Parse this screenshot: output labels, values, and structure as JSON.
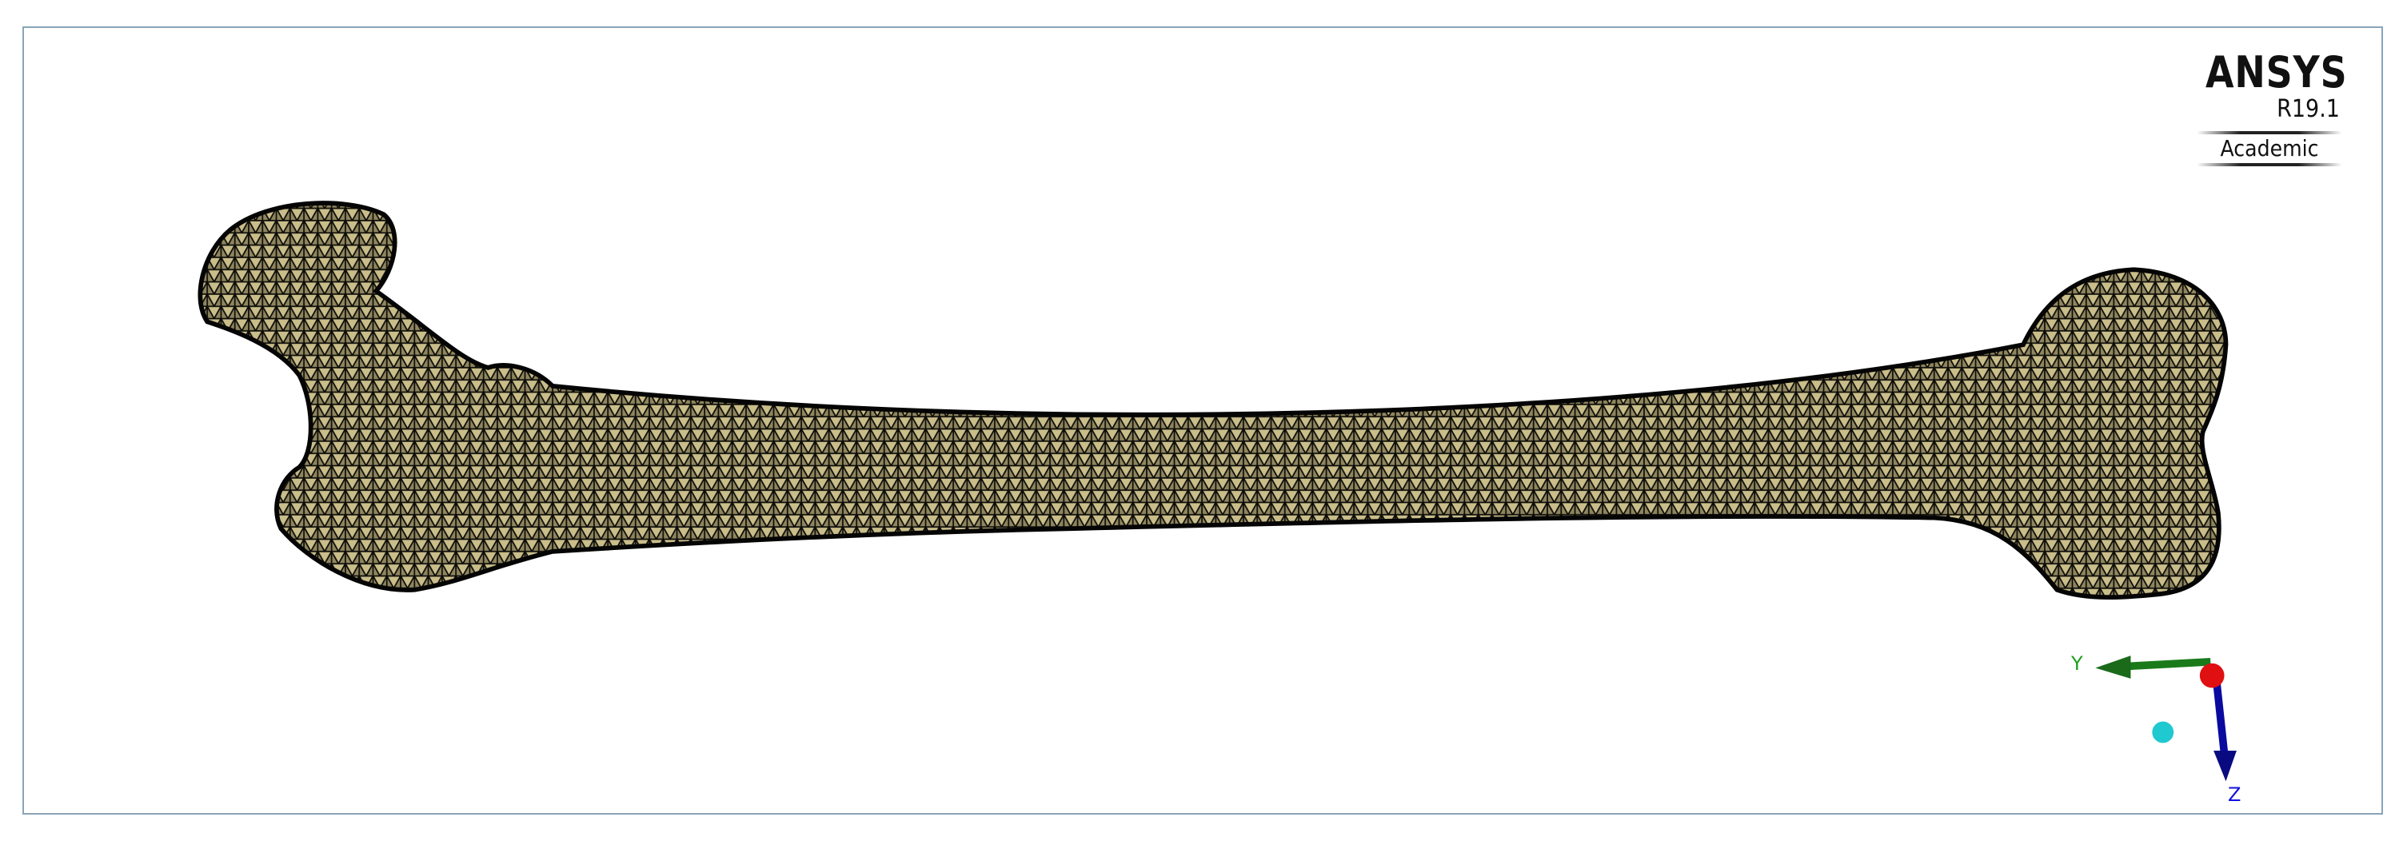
{
  "viewport": {
    "logo": {
      "brand": "ANSYS",
      "version": "R19.1",
      "edition": "Academic"
    },
    "model": {
      "name": "femur-mesh",
      "mesh_color": "#d8cc98",
      "edge_color": "#0c0c08"
    },
    "triad": {
      "y_label": "Y",
      "z_label": "Z",
      "y_color": "#1a7a1a",
      "z_color": "#0a0aa0",
      "origin_color": "#e01010",
      "iso_color": "#20c8d0"
    }
  }
}
